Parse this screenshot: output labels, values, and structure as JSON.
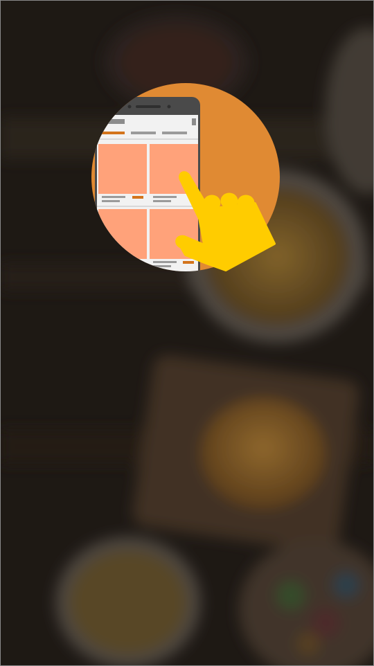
{
  "screen": {
    "name": "splash-onboarding",
    "accent_color": "#e08a33",
    "hand_color": "#ffcc00",
    "tile_color": "#ffa27a"
  },
  "illustration": {
    "icon": "phone-tap-illustration-icon"
  }
}
